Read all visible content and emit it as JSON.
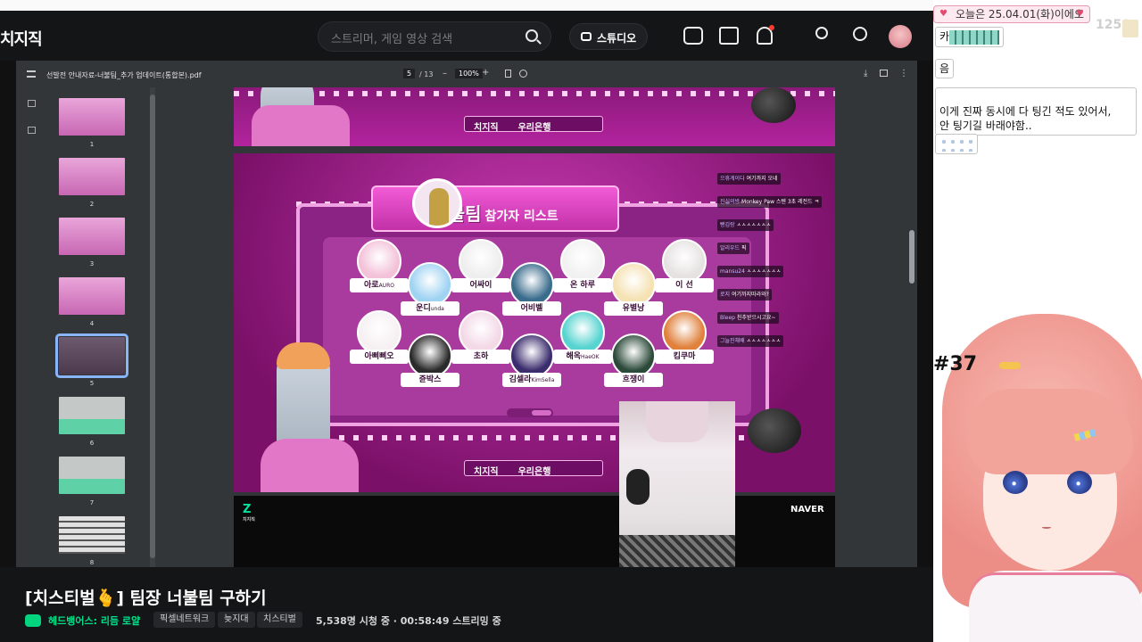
{
  "header": {
    "logo": "치지직",
    "search_placeholder": "스트리머, 게임 영상 검색",
    "studio_label": "스튜디오"
  },
  "pdf": {
    "filename": "선발전 안내자료-너불팀_추가 업데이트(통합본).pdf",
    "page_current": "5",
    "page_total": "/ 13",
    "zoom": "100%",
    "thumbs": [
      {
        "num": "1",
        "style": "pink"
      },
      {
        "num": "2",
        "style": "pink"
      },
      {
        "num": "3",
        "style": "pink"
      },
      {
        "num": "4",
        "style": "pink"
      },
      {
        "num": "5",
        "style": "dark"
      },
      {
        "num": "6",
        "style": "green"
      },
      {
        "num": "7",
        "style": "green"
      },
      {
        "num": "8",
        "style": "list"
      }
    ]
  },
  "slide": {
    "sponsor_a": "치지직",
    "sponsor_b": "우리은행",
    "title_main": "너불팀",
    "title_sub": "참가자 리스트",
    "members": [
      {
        "name": "아로",
        "sub": "AURO",
        "color": "#f3c2d9"
      },
      {
        "name": "운디",
        "sub": "unda",
        "color": "#9fd3f2"
      },
      {
        "name": "어싸이",
        "sub": "",
        "color": "#eeeeee"
      },
      {
        "name": "어비벨",
        "sub": "",
        "color": "#3a6c8c"
      },
      {
        "name": "온 하루",
        "sub": "",
        "color": "#f1f1f1"
      },
      {
        "name": "유별낭",
        "sub": "",
        "color": "#f5e2b3"
      },
      {
        "name": "이 선",
        "sub": "",
        "color": "#e6e2e2"
      },
      {
        "name": "아삐삐오",
        "sub": "",
        "color": "#f6f0f3"
      },
      {
        "name": "쥰박스",
        "sub": "",
        "color": "#2b2b2b"
      },
      {
        "name": "초하",
        "sub": "",
        "color": "#f3d9e6"
      },
      {
        "name": "김셀라",
        "sub": "KimSella",
        "color": "#3a2c6d"
      },
      {
        "name": "해옥",
        "sub": "HaeOK",
        "color": "#57d4d0"
      },
      {
        "name": "흐쟁이",
        "sub": "",
        "color": "#2c4a3a"
      },
      {
        "name": "킴쿠마",
        "sub": "",
        "color": "#e0813c"
      }
    ],
    "chat": [
      {
        "user": "으휴게이다",
        "msg": "여기까지 오네"
      },
      {
        "user": "진실의방",
        "msg": "Monkey Paw 스텐 3초 레전드 ㅋ"
      },
      {
        "user": "빵김랑",
        "msg": "ㅅㅅㅅㅅㅅㅅㅅ"
      },
      {
        "user": "알리우드",
        "msg": "픽"
      },
      {
        "user": "mansu24",
        "msg": "ㅅㅅㅅㅅㅅㅅㅅ"
      },
      {
        "user": "로지",
        "msg": "여기까지따라와?"
      },
      {
        "user": "Bleep",
        "msg": "친추받으시고요~"
      },
      {
        "user": "그늘진채배",
        "msg": "ㅅㅅㅅㅅㅅㅅㅅ"
      }
    ],
    "footer_logo": "Z",
    "footer_logo_sub": "치지직",
    "naver": "NAVER"
  },
  "stream": {
    "title": "[치스티벌🫰] 팀장 너불팀 구하기",
    "channel": "헤드뱅어스: 리듬 로얄",
    "tags": [
      "픽셀네트워크",
      "늦지대",
      "치스티벌"
    ],
    "meta": "5,538명 시청 중 · 00:58:49 스트리밍 중"
  },
  "right_panel": {
    "date_banner": "오늘은 25.04.01(화)이에오",
    "count_peek": "1250",
    "bubbles": [
      {
        "text": "카",
        "emote": true
      },
      {
        "text": "음",
        "emote": false
      },
      {
        "text": "이게 진짜 동시에 다 팅긴 적도 있어서,\n안 팅기길 바래야함..",
        "emote": false
      },
      {
        "text": "",
        "emote2": true
      }
    ],
    "side_number": "#37"
  }
}
